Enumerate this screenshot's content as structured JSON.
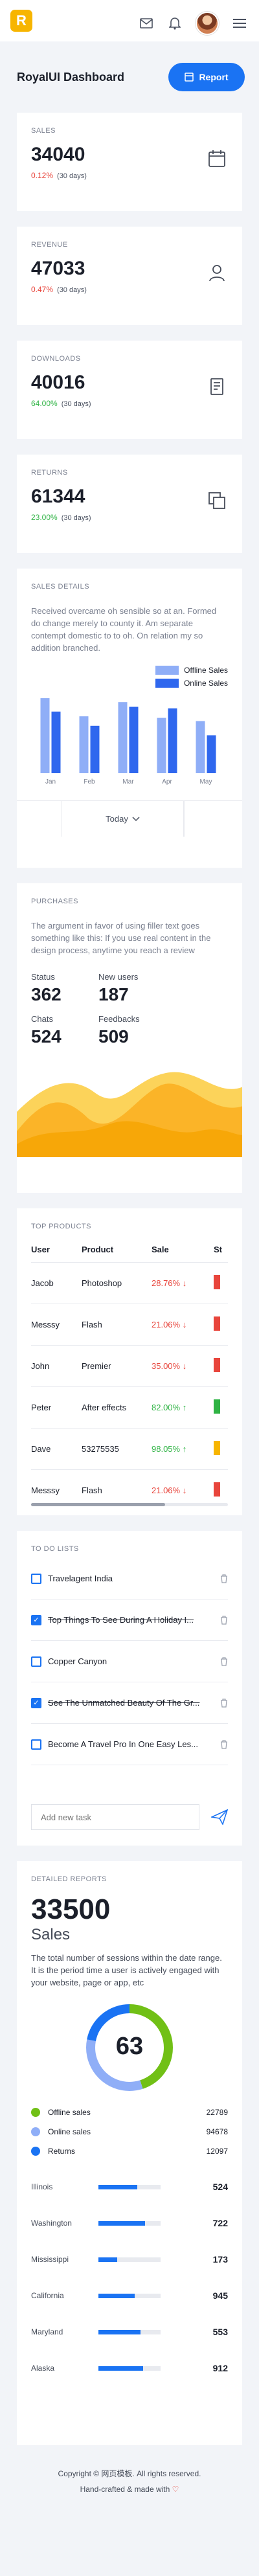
{
  "header": {
    "logo_letter": "R"
  },
  "page": {
    "title": "RoyalUI Dashboard",
    "report_button": "Report"
  },
  "stats": [
    {
      "label": "SALES",
      "value": "34040",
      "change": "0.12%",
      "period": "(30 days)",
      "trend": "red",
      "icon": "calendar-icon"
    },
    {
      "label": "REVENUE",
      "value": "47033",
      "change": "0.47%",
      "period": "(30 days)",
      "trend": "red",
      "icon": "user-icon"
    },
    {
      "label": "DOWNLOADS",
      "value": "40016",
      "change": "64.00%",
      "period": "(30 days)",
      "trend": "green",
      "icon": "document-icon"
    },
    {
      "label": "RETURNS",
      "value": "61344",
      "change": "23.00%",
      "period": "(30 days)",
      "trend": "green",
      "icon": "copy-icon"
    }
  ],
  "sales_details": {
    "label": "SALES DETAILS",
    "description": "Received overcame oh sensible so at an. Formed do change merely to county it. Am separate contempt domestic to to oh. On relation my so addition branched.",
    "legend_offline": "Offline Sales",
    "legend_online": "Online Sales",
    "dropdown": "Today"
  },
  "chart_data": {
    "type": "bar",
    "categories": [
      "Jan",
      "Feb",
      "Mar",
      "Apr",
      "May"
    ],
    "series": [
      {
        "name": "Offline Sales",
        "values": [
          95,
          72,
          90,
          70,
          66
        ]
      },
      {
        "name": "Online Sales",
        "values": [
          78,
          60,
          84,
          82,
          48
        ]
      }
    ],
    "colors": {
      "Offline Sales": "#8faef7",
      "Online Sales": "#2f67ee"
    },
    "ylim": [
      0,
      100
    ]
  },
  "purchases": {
    "label": "PURCHASES",
    "description": "The argument in favor of using filler text goes something like this: If you use real content in the design process, anytime you reach a review",
    "metrics": [
      {
        "label": "Status",
        "value": "362"
      },
      {
        "label": "New users",
        "value": "187"
      },
      {
        "label": "Chats",
        "value": "524"
      },
      {
        "label": "Feedbacks",
        "value": "509"
      }
    ]
  },
  "top_products": {
    "label": "TOP PRODUCTS",
    "headers": [
      "User",
      "Product",
      "Sale",
      "St"
    ],
    "rows": [
      {
        "user": "Jacob",
        "product": "Photoshop",
        "sale": "28.76%",
        "dir": "down",
        "bar_color": "#e8453c"
      },
      {
        "user": "Messsy",
        "product": "Flash",
        "sale": "21.06%",
        "dir": "down",
        "bar_color": "#e8453c"
      },
      {
        "user": "John",
        "product": "Premier",
        "sale": "35.00%",
        "dir": "down",
        "bar_color": "#e8453c"
      },
      {
        "user": "Peter",
        "product": "After effects",
        "sale": "82.00%",
        "dir": "up",
        "bar_color": "#2fb344"
      },
      {
        "user": "Dave",
        "product": "53275535",
        "sale": "98.05%",
        "dir": "up",
        "bar_color": "#f7b500"
      },
      {
        "user": "Messsy",
        "product": "Flash",
        "sale": "21.06%",
        "dir": "down",
        "bar_color": "#e8453c"
      }
    ]
  },
  "todo": {
    "label": "TO DO LISTS",
    "items": [
      {
        "text": "Travelagent India",
        "done": false
      },
      {
        "text": "Top Things To See During A Holiday I...",
        "done": true
      },
      {
        "text": "Copper Canyon",
        "done": false
      },
      {
        "text": "See The Unmatched Beauty Of The Gr...",
        "done": true
      },
      {
        "text": "Become A Travel Pro In One Easy Les...",
        "done": false
      }
    ],
    "new_task_placeholder": "Add new task"
  },
  "detailed_reports": {
    "label": "DETAILED REPORTS",
    "value": "33500",
    "subtitle": "Sales",
    "description": "The total number of sessions within the date range. It is the period time a user is actively engaged with your website, page or app, etc",
    "donut_center": "63",
    "legend": [
      {
        "name": "Offline sales",
        "value": "22789",
        "color": "#71c016"
      },
      {
        "name": "Online sales",
        "value": "94678",
        "color": "#8faef7"
      },
      {
        "name": "Returns",
        "value": "12097",
        "color": "#1a73f3"
      }
    ],
    "donut_fractions": [
      0.45,
      0.33,
      0.22
    ],
    "cities": [
      {
        "name": "Illinois",
        "value": "524",
        "fill": 0.62
      },
      {
        "name": "Washington",
        "value": "722",
        "fill": 0.75
      },
      {
        "name": "Mississippi",
        "value": "173",
        "fill": 0.3
      },
      {
        "name": "California",
        "value": "945",
        "fill": 0.58
      },
      {
        "name": "Maryland",
        "value": "553",
        "fill": 0.68
      },
      {
        "name": "Alaska",
        "value": "912",
        "fill": 0.72
      }
    ]
  },
  "footer": {
    "copyright": "Copyright © 网页模板. All rights reserved.",
    "handcrafted": "Hand-crafted & made with"
  }
}
